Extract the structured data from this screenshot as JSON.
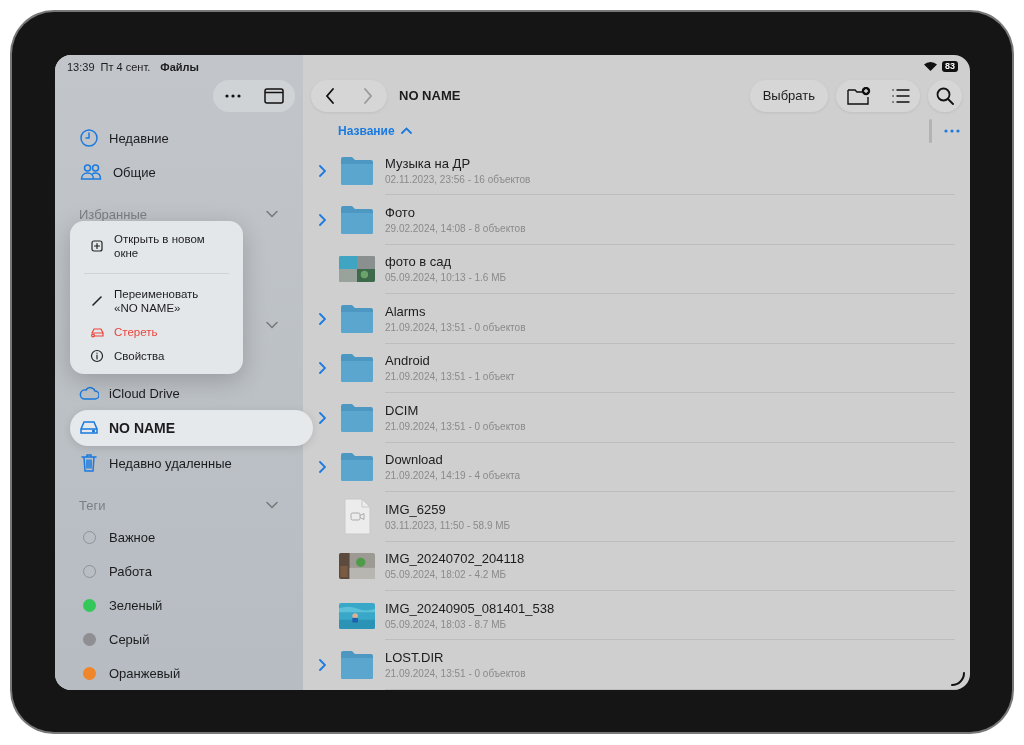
{
  "status_bar": {
    "time": "13:39",
    "date": "Пт 4 сент.",
    "app": "Файлы",
    "battery": "83"
  },
  "sidebar": {
    "items": [
      {
        "label": "Недавние",
        "kind": "clock"
      },
      {
        "label": "Общие",
        "kind": "people"
      }
    ],
    "favorites": {
      "title": "Избранные",
      "expanded": true
    },
    "locations": {
      "expanded": true,
      "items": [
        {
          "label": "iCloud Drive",
          "kind": "cloud",
          "selected": false
        },
        {
          "label": "NO NAME",
          "kind": "drive",
          "selected": true
        },
        {
          "label": "Недавно удаленные",
          "kind": "trash",
          "selected": false
        }
      ]
    },
    "tags": {
      "title": "Теги",
      "expanded": true,
      "items": [
        {
          "label": "Важное"
        },
        {
          "label": "Работа"
        },
        {
          "label": "Зеленый",
          "color": "#34c759"
        },
        {
          "label": "Серый",
          "color": "#8e8e93"
        },
        {
          "label": "Оранжевый",
          "color": "#f0862a"
        }
      ]
    }
  },
  "context_menu": {
    "groups": [
      [
        {
          "label": "Открыть в новом окне",
          "kind": "open"
        }
      ],
      [
        {
          "label": "Переименовать «NO NAME»",
          "kind": "rename"
        },
        {
          "label": "Стереть",
          "kind": "erase"
        },
        {
          "label": "Свойства",
          "kind": "info"
        }
      ]
    ]
  },
  "toolbar": {
    "title": "NO NAME",
    "select_button": "Выбрать"
  },
  "sort": {
    "label": "Название",
    "ascending": true
  },
  "files": [
    {
      "name": "Музыка на ДР",
      "meta": "02.11.2023, 23:56 - 16 объектов",
      "kind": "folder"
    },
    {
      "name": "Фото",
      "meta": "29.02.2024, 14:08 - 8 объектов",
      "kind": "folder"
    },
    {
      "name": "фото в сад",
      "meta": "05.09.2024, 10:13 - 1.6 МБ"
    },
    {
      "name": "Alarms",
      "meta": "21.09.2024, 13:51 - 0 объектов",
      "kind": "folder"
    },
    {
      "name": "Android",
      "meta": "21.09.2024, 13:51 - 1 объект",
      "kind": "folder"
    },
    {
      "name": "DCIM",
      "meta": "21.09.2024, 13:51 - 0 объектов",
      "kind": "folder"
    },
    {
      "name": "Download",
      "meta": "21.09.2024, 14:19 - 4 объекта",
      "kind": "folder"
    },
    {
      "name": "IMG_6259",
      "meta": "03.11.2023, 11:50 - 58.9 МБ",
      "kind": "video"
    },
    {
      "name": "IMG_20240702_204118",
      "meta": "05.09.2024, 18:02 - 4.2 МБ"
    },
    {
      "name": "IMG_20240905_081401_538",
      "meta": "05.09.2024, 18:03 - 8.7 МБ"
    },
    {
      "name": "LOST.DIR",
      "meta": "21.09.2024, 13:51 - 0 объектов",
      "kind": "folder"
    }
  ]
}
